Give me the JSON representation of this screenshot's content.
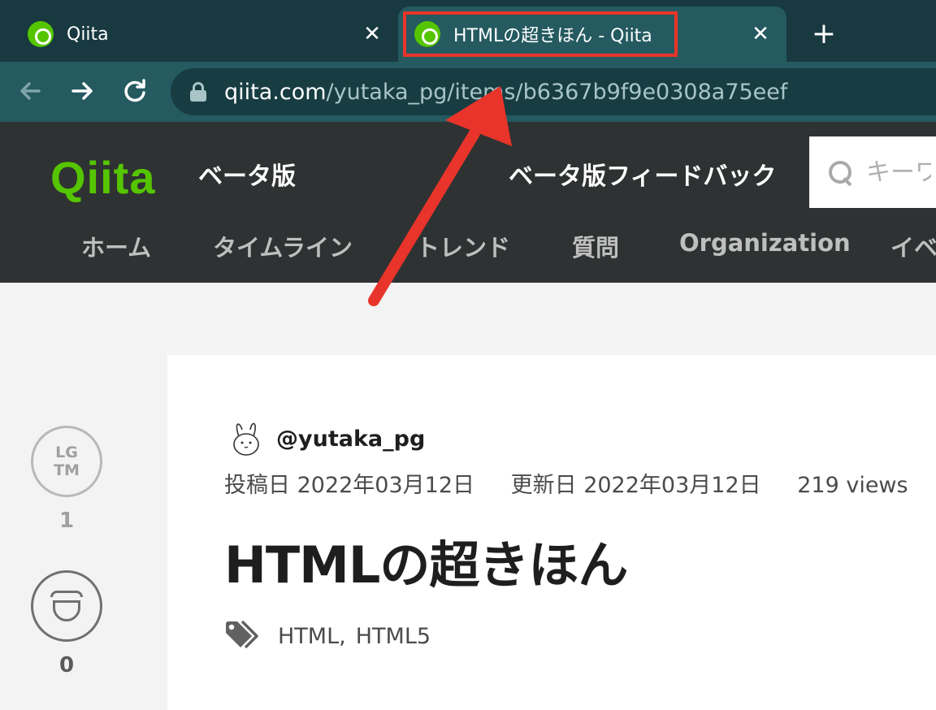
{
  "browser": {
    "tabs": [
      {
        "title": "Qiita",
        "active": false
      },
      {
        "title": "HTMLの超きほん - Qiita",
        "active": true
      }
    ],
    "close_glyph": "✕",
    "new_tab_glyph": "+",
    "url_host": "qiita.com",
    "url_path": "/yutaka_pg/items/b6367b9f9e0308a75eef",
    "icons": {
      "back": "arrow-left-icon",
      "forward": "arrow-right-icon",
      "reload": "reload-icon",
      "lock": "lock-icon"
    }
  },
  "header": {
    "logo": "Qiita",
    "beta_label": "ベータ版",
    "feedback_label": "ベータ版フィードバック",
    "search_placeholder": "キーワ",
    "nav": [
      "ホーム",
      "タイムライン",
      "トレンド",
      "質問",
      "Organization",
      "イベ"
    ]
  },
  "article": {
    "author": "@yutaka_pg",
    "posted": "投稿日 2022年03月12日",
    "updated": "更新日 2022年03月12日",
    "views": "219 views",
    "title": "HTMLの超きほん",
    "tags": [
      "HTML",
      "HTML5"
    ],
    "tag_separator": ","
  },
  "sidebar": {
    "lgtm_line1": "LG",
    "lgtm_line2": "TM",
    "lgtm_count": "1",
    "stock_count": "0"
  },
  "colors": {
    "annotation": "#e8342a",
    "qiita_green": "#55c500",
    "tabbar": "#17393f",
    "toolbar": "#245a60"
  }
}
